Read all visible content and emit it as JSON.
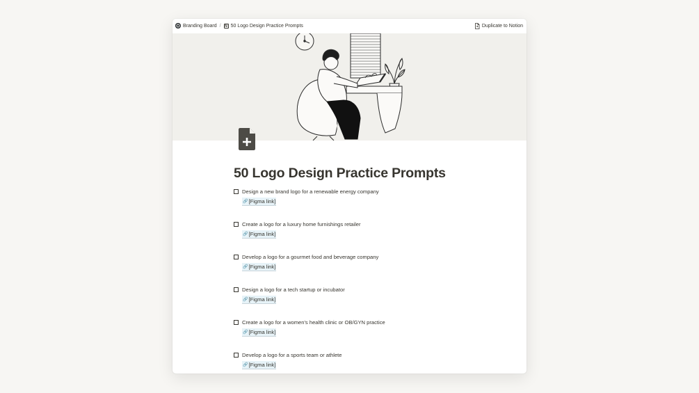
{
  "breadcrumb": {
    "workspace": "Branding Board",
    "separator": "/",
    "page": "50 Logo Design Practice Prompts"
  },
  "header_action": {
    "label": "Duplicate to Notion"
  },
  "page": {
    "title": "50 Logo Design Practice Prompts"
  },
  "todos": [
    {
      "text": "Design a new brand logo for a renewable energy company",
      "link": "[Figma link]"
    },
    {
      "text": "Create a logo for a luxury home furnishings retailer",
      "link": "[Figma link]"
    },
    {
      "text": "Develop a logo for a gourmet food and beverage company",
      "link": "[Figma link]"
    },
    {
      "text": "Design a logo for a tech startup or incubator",
      "link": "[Figma link]"
    },
    {
      "text": "Create a logo for a women's health clinic or OB/GYN practice",
      "link": "[Figma link]"
    },
    {
      "text": "Develop a logo for a sports team or athlete",
      "link": "[Figma link]"
    }
  ],
  "colors": {
    "background": "#f7f6f3",
    "text": "#37352f",
    "link_highlight": "#e7f3f8",
    "cover": "#f1f0ec"
  },
  "icons": {
    "link": "link-icon",
    "page": "page-add-icon"
  }
}
